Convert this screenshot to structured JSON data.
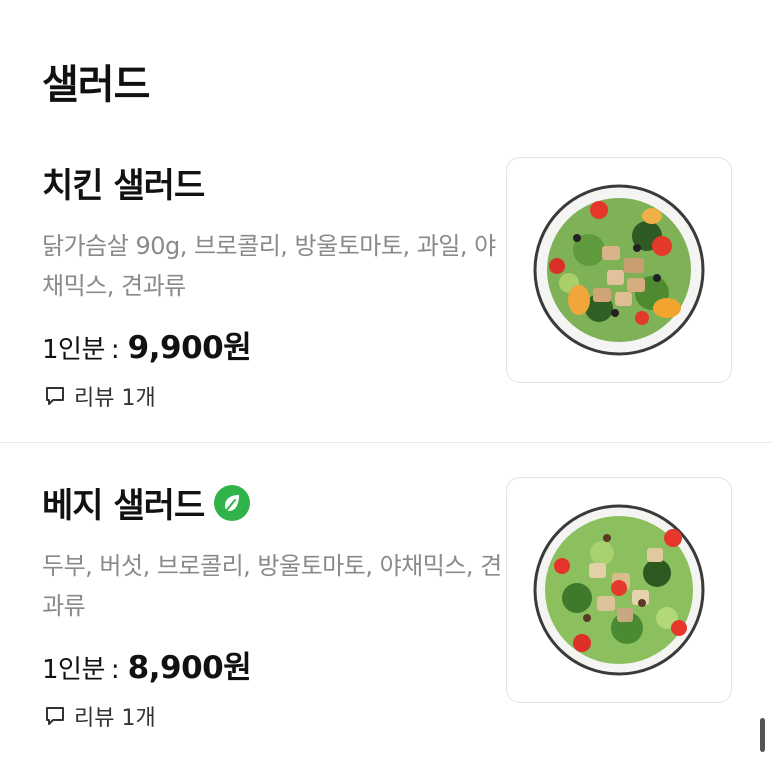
{
  "header": {
    "title": "샐러드"
  },
  "items": [
    {
      "name": "치킨 샐러드",
      "description": "닭가슴살 90g, 브로콜리, 방울토마토, 과일, 야채믹스, 견과류",
      "price_label": "1인분",
      "price_sep": ":",
      "price": "9,900원",
      "review_label": "리뷰 1개",
      "image_icon": "chicken-salad-photo"
    },
    {
      "name": "베지 샐러드",
      "badge_icon": "vegan-leaf-icon",
      "badge_color": "#2fb34a",
      "description": "두부, 버섯, 브로콜리, 방울토마토, 야채믹스, 견과류",
      "price_label": "1인분",
      "price_sep": ":",
      "price": "8,900원",
      "review_label": "리뷰 1개",
      "image_icon": "veggie-salad-photo"
    }
  ]
}
